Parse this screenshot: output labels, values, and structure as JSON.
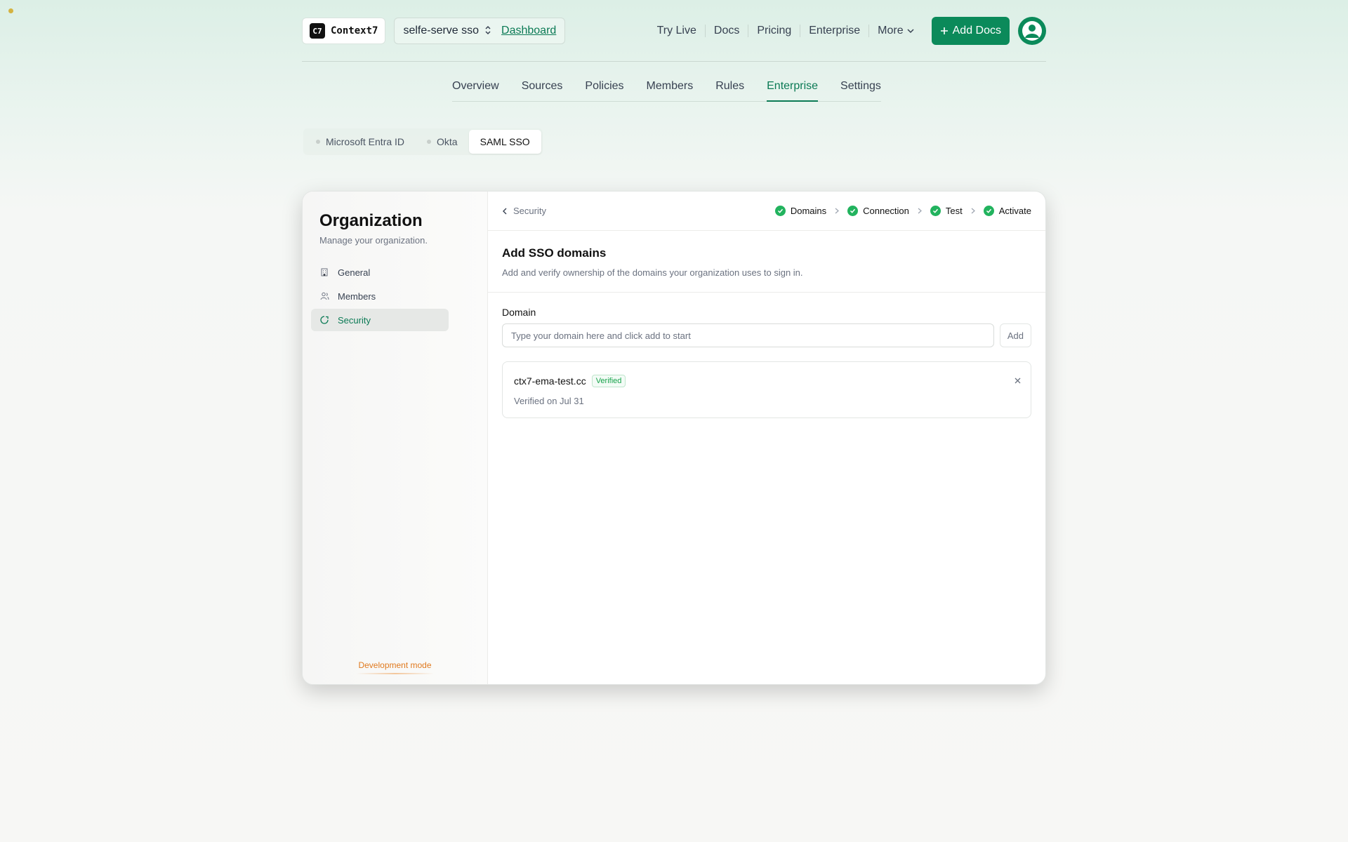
{
  "header": {
    "logo_mark": "C7",
    "logo_text": "Context7",
    "project_name": "selfe-serve sso",
    "dashboard_link": "Dashboard",
    "nav": [
      "Try Live",
      "Docs",
      "Pricing",
      "Enterprise"
    ],
    "more_label": "More",
    "add_docs_label": "Add Docs"
  },
  "tabs": [
    "Overview",
    "Sources",
    "Policies",
    "Members",
    "Rules",
    "Enterprise",
    "Settings"
  ],
  "active_tab": "Enterprise",
  "subtabs": [
    {
      "label": "Microsoft Entra ID"
    },
    {
      "label": "Okta"
    },
    {
      "label": "SAML SSO"
    }
  ],
  "sidebar": {
    "title": "Organization",
    "subtitle": "Manage your organization.",
    "items": [
      {
        "label": "General",
        "icon": "building-icon"
      },
      {
        "label": "Members",
        "icon": "users-icon"
      },
      {
        "label": "Security",
        "icon": "shield-icon"
      }
    ],
    "dev_mode": "Development mode"
  },
  "main": {
    "back_label": "Security",
    "steps": [
      "Domains",
      "Connection",
      "Test",
      "Activate"
    ],
    "section_title": "Add SSO domains",
    "section_desc": "Add and verify ownership of the domains your organization uses to sign in.",
    "field_label": "Domain",
    "input_placeholder": "Type your domain here and click add to start",
    "input_value": "",
    "add_label": "Add",
    "domain": {
      "name": "ctx7-ema-test.cc",
      "badge": "Verified",
      "sub": "Verified on Jul 31"
    }
  },
  "colors": {
    "accent": "#0b8a5a",
    "check": "#22b35e",
    "dev_mode": "#e07a1f"
  }
}
